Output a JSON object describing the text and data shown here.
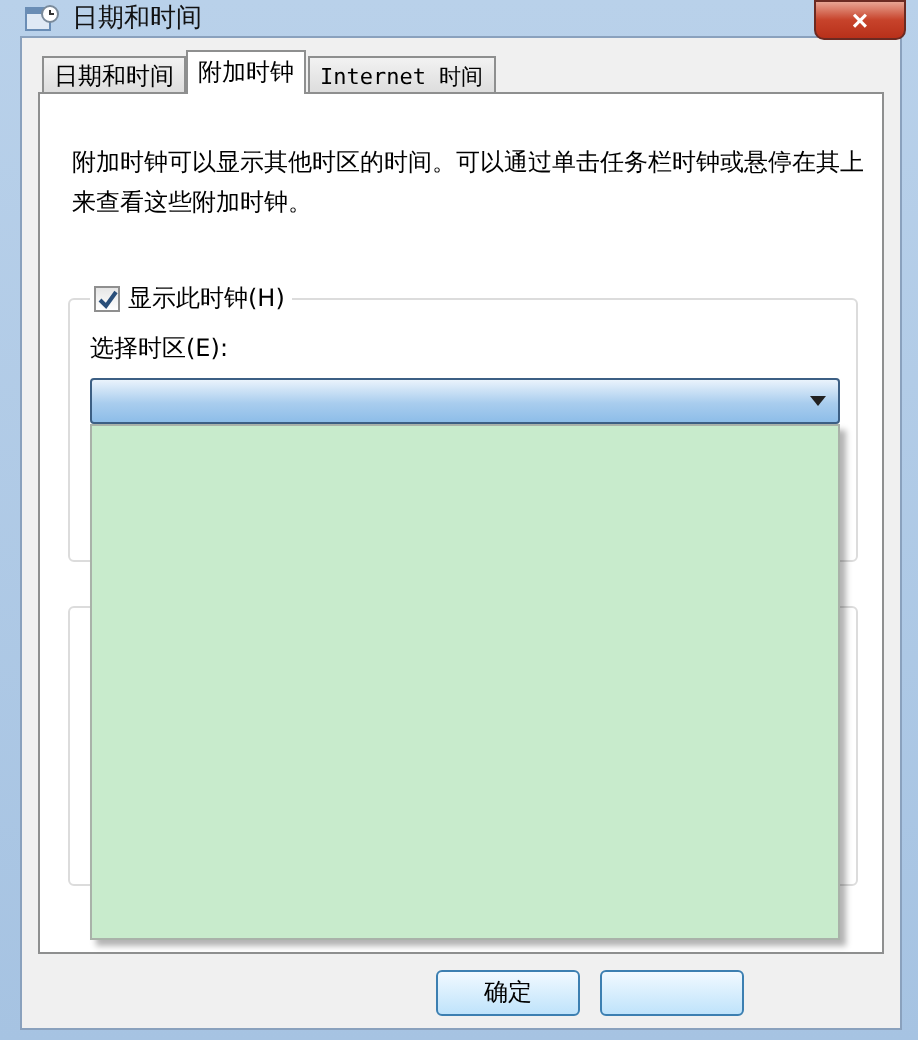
{
  "window": {
    "title": "日期和时间",
    "close": "×"
  },
  "tabs": [
    {
      "label": "日期和时间",
      "selected": false
    },
    {
      "label": "附加时钟",
      "selected": true
    },
    {
      "label": "Internet 时间",
      "selected": false
    }
  ],
  "description": "附加时钟可以显示其他时区的时间。可以通过单击任务栏时钟或悬停在其上来查看这些附加时钟。",
  "clock_group": {
    "label": "显示此时钟(H)",
    "checked": true,
    "timezone_label": "选择时区(E):",
    "dropdown": {
      "expanded": true
    }
  },
  "buttons": [
    {
      "label": "确定"
    },
    {
      "kind": "blank"
    }
  ]
}
